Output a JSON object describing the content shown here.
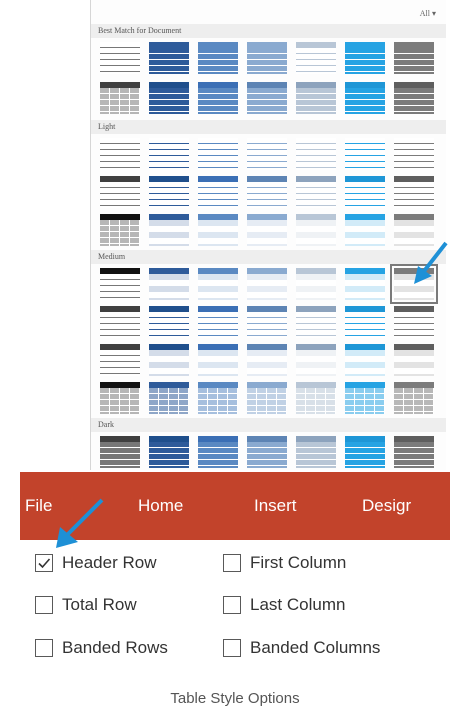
{
  "gallery": {
    "all_label": "All ▾",
    "sections": [
      {
        "title": "Best Match for Document"
      },
      {
        "title": "Light"
      },
      {
        "title": "Medium"
      },
      {
        "title": "Dark"
      }
    ],
    "palette": [
      "#ffffff",
      "#2e5b9a",
      "#5a89c2",
      "#8aaad0",
      "#b8c6d6",
      "#26a3e3",
      "#7b7b7b"
    ],
    "darkPalette": [
      "#3f3f3f",
      "#1f4f8c",
      "#3b6fb5",
      "#5d84b4",
      "#8da3bd",
      "#1e96d6",
      "#5e5e5e"
    ],
    "selected_style": "Medium, column 7"
  },
  "ribbon": {
    "accent": "#c2432b",
    "tabs": [
      {
        "label": "File"
      },
      {
        "label": "Home"
      },
      {
        "label": "Insert"
      },
      {
        "label": "Desigr"
      }
    ]
  },
  "table_style_options": {
    "group_label": "Table Style Options",
    "items": [
      {
        "label": "Header Row",
        "checked": true
      },
      {
        "label": "First Column",
        "checked": false
      },
      {
        "label": "Total Row",
        "checked": false
      },
      {
        "label": "Last Column",
        "checked": false
      },
      {
        "label": "Banded Rows",
        "checked": false
      },
      {
        "label": "Banded Columns",
        "checked": false
      }
    ]
  },
  "annotations": {
    "arrow_color": "#1e90d6"
  }
}
